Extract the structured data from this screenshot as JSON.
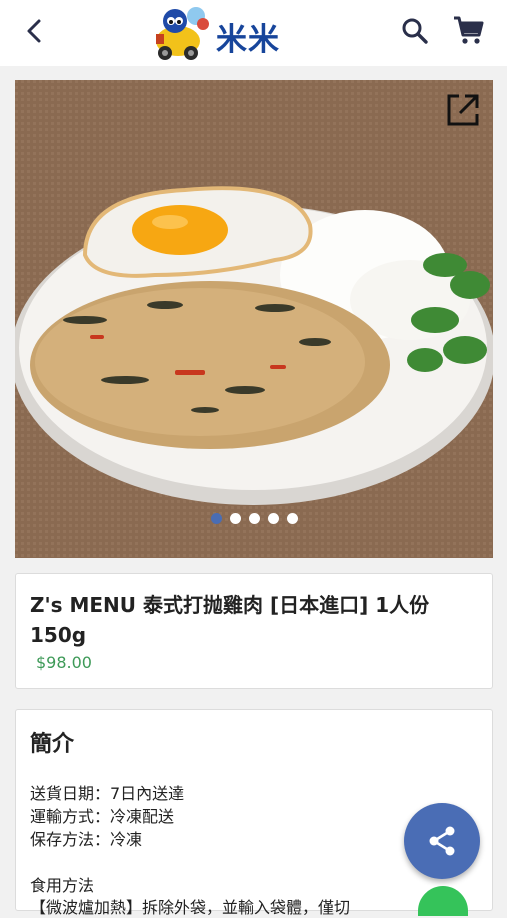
{
  "header": {
    "logo_text": "米米",
    "back_icon": "chevron-left-icon",
    "search_icon": "search-icon",
    "cart_icon": "shopping-cart-icon"
  },
  "gallery": {
    "image_subject": "Thai basil minced chicken with fried egg and rice",
    "open_icon": "open-in-new-icon",
    "slide_count": 5,
    "active_slide": 1
  },
  "product": {
    "title": "Z's MENU 泰式打抛雞肉 [日本進口] 1人份 150g",
    "price": "$98.00"
  },
  "intro": {
    "heading": "簡介",
    "delivery_date": "送貨日期：7日內送達",
    "transport": "運輸方式：冷凍配送",
    "storage": "保存方法：冷凍",
    "usage_heading": "食用方法",
    "usage_text": "【微波爐加熱】拆除外袋，並輸入袋體，僅切"
  },
  "fab": {
    "share_icon": "share-icon"
  },
  "colors": {
    "brand_blue": "#17459b",
    "price_green": "#3e9a58",
    "fab_blue": "#4a6db5"
  }
}
